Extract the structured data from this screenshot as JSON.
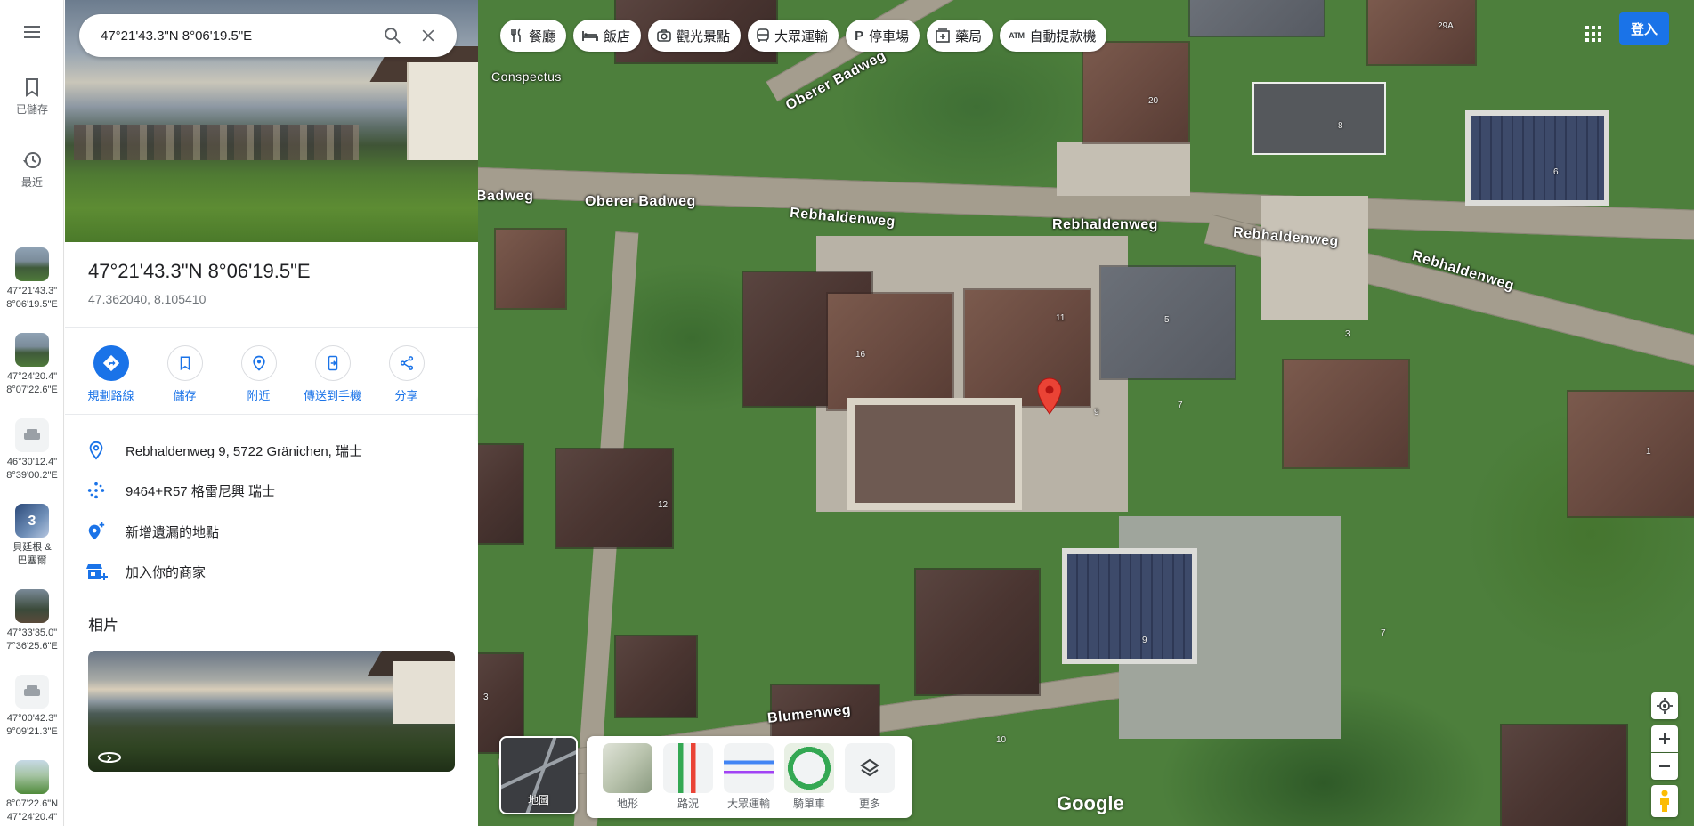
{
  "search": {
    "value": "47°21'43.3\"N 8°06'19.5\"E",
    "placeholder": ""
  },
  "rail": {
    "saved_label": "已儲存",
    "recent_label": "最近",
    "history": [
      {
        "line1": "47°21'43.3\"",
        "line2": "8°06'19.5\"E"
      },
      {
        "line1": "47°24'20.4\"",
        "line2": "8°07'22.6\"E"
      },
      {
        "line1": "46°30'12.4\"",
        "line2": "8°39'00.2\"E"
      },
      {
        "badge": "3",
        "line1": "貝廷根 &",
        "line2": "巴塞爾"
      },
      {
        "line1": "47°33'35.0\"",
        "line2": "7°36'25.6\"E"
      },
      {
        "line1": "47°00'42.3\"",
        "line2": "9°09'21.3\"E"
      },
      {
        "line1": "8°07'22.6\"N",
        "line2": "47°24'20.4\""
      }
    ]
  },
  "place": {
    "title": "47°21'43.3\"N 8°06'19.5\"E",
    "decimal": "47.362040, 8.105410"
  },
  "actions": [
    {
      "label": "規劃路線"
    },
    {
      "label": "儲存"
    },
    {
      "label": "附近"
    },
    {
      "label": "傳送到手機"
    },
    {
      "label": "分享"
    }
  ],
  "info": {
    "address": "Rebhaldenweg 9, 5722 Gränichen, 瑞士",
    "plus_code": "9464+R57 格雷尼興 瑞士",
    "add_missing": "新增遺漏的地點",
    "add_business": "加入你的商家"
  },
  "photos_title": "相片",
  "chips": [
    {
      "icon": "fork-knife-icon",
      "label": "餐廳"
    },
    {
      "icon": "bed-icon",
      "label": "飯店"
    },
    {
      "icon": "camera-icon",
      "label": "觀光景點"
    },
    {
      "icon": "bus-icon",
      "label": "大眾運輸"
    },
    {
      "icon": "parking-icon",
      "label": "停車場"
    },
    {
      "icon": "pharmacy-icon",
      "label": "藥局"
    },
    {
      "icon": "atm-icon",
      "label": "自動提款機"
    }
  ],
  "signin_label": "登入",
  "layers": {
    "main_label": "地圖",
    "items": [
      {
        "label": "地形"
      },
      {
        "label": "路況"
      },
      {
        "label": "大眾運輸"
      },
      {
        "label": "騎單車"
      },
      {
        "label": "更多"
      }
    ]
  },
  "map": {
    "streets": [
      "Conspectus",
      "Oberer Badweg",
      "Badweg",
      "Oberer Badweg",
      "Rebhaldenweg",
      "Rebhaldenweg",
      "Rebhaldenweg",
      "Rebhaldenweg",
      "Blumenweg"
    ],
    "house_numbers": [
      "20",
      "29A",
      "8",
      "6",
      "11",
      "5",
      "3",
      "16",
      "9",
      "7",
      "12",
      "1",
      "9",
      "7",
      "10",
      "3"
    ]
  },
  "google_logo": "Google",
  "colors": {
    "accent": "#1a73e8",
    "pin": "#ea4335"
  }
}
